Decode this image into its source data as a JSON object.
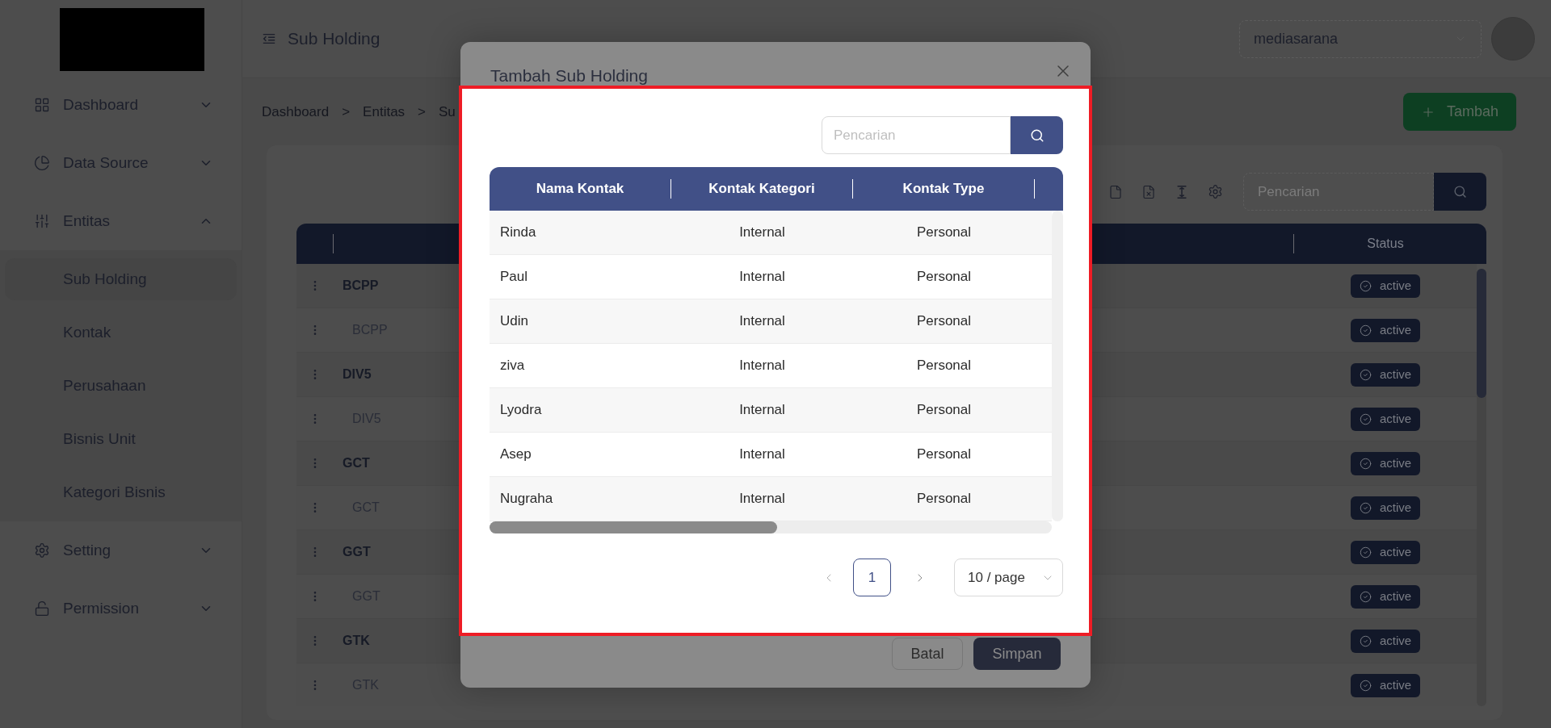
{
  "sidebar": {
    "items": [
      {
        "label": "Dashboard",
        "expanded": false
      },
      {
        "label": "Data Source",
        "expanded": false
      },
      {
        "label": "Entitas",
        "expanded": true,
        "children": [
          {
            "label": "Sub Holding",
            "selected": true
          },
          {
            "label": "Kontak",
            "selected": false
          },
          {
            "label": "Perusahaan",
            "selected": false
          },
          {
            "label": "Bisnis Unit",
            "selected": false
          },
          {
            "label": "Kategori Bisnis",
            "selected": false
          }
        ]
      },
      {
        "label": "Setting",
        "expanded": false
      },
      {
        "label": "Permission",
        "expanded": false
      }
    ]
  },
  "header": {
    "title": "Sub Holding",
    "company_select": "mediasarana"
  },
  "breadcrumb": [
    "Dashboard",
    ">",
    "Entitas",
    ">",
    "Su"
  ],
  "add_button": "Tambah",
  "table": {
    "search_placeholder": "Pencarian",
    "columns": [
      "Status"
    ],
    "rows": [
      {
        "name": "BCPP",
        "status": "active",
        "children": [
          {
            "name": "BCPP",
            "status": "active"
          }
        ]
      },
      {
        "name": "DIV5",
        "status": "active",
        "children": [
          {
            "name": "DIV5",
            "status": "active"
          }
        ]
      },
      {
        "name": "GCT",
        "status": "active",
        "children": [
          {
            "name": "GCT",
            "status": "active"
          }
        ]
      },
      {
        "name": "GGT",
        "status": "active",
        "children": [
          {
            "name": "GGT",
            "status": "active"
          }
        ]
      },
      {
        "name": "GTK",
        "status": "active",
        "children": [
          {
            "name": "GTK",
            "status": "active"
          }
        ]
      }
    ]
  },
  "modal": {
    "title": "Tambah Sub Holding",
    "buttons": [
      {
        "label": "Batal",
        "kind": "secondary"
      },
      {
        "label": "Simpan",
        "kind": "primary"
      }
    ],
    "contact_picker": {
      "search_placeholder": "Pencarian",
      "columns": [
        "Nama Kontak",
        "Kontak Kategori",
        "Kontak Type"
      ],
      "rows": [
        {
          "name": "Rinda",
          "category": "Internal",
          "type": "Personal"
        },
        {
          "name": "Paul",
          "category": "Internal",
          "type": "Personal"
        },
        {
          "name": "Udin",
          "category": "Internal",
          "type": "Personal"
        },
        {
          "name": "ziva",
          "category": "Internal",
          "type": "Personal"
        },
        {
          "name": "Lyodra",
          "category": "Internal",
          "type": "Personal"
        },
        {
          "name": "Asep",
          "category": "Internal",
          "type": "Personal"
        },
        {
          "name": "Nugraha",
          "category": "Internal",
          "type": "Personal"
        }
      ],
      "pagination": {
        "pages": [
          {
            "label": "1",
            "selected": true
          }
        ],
        "page_size": "10 / page"
      }
    }
  }
}
